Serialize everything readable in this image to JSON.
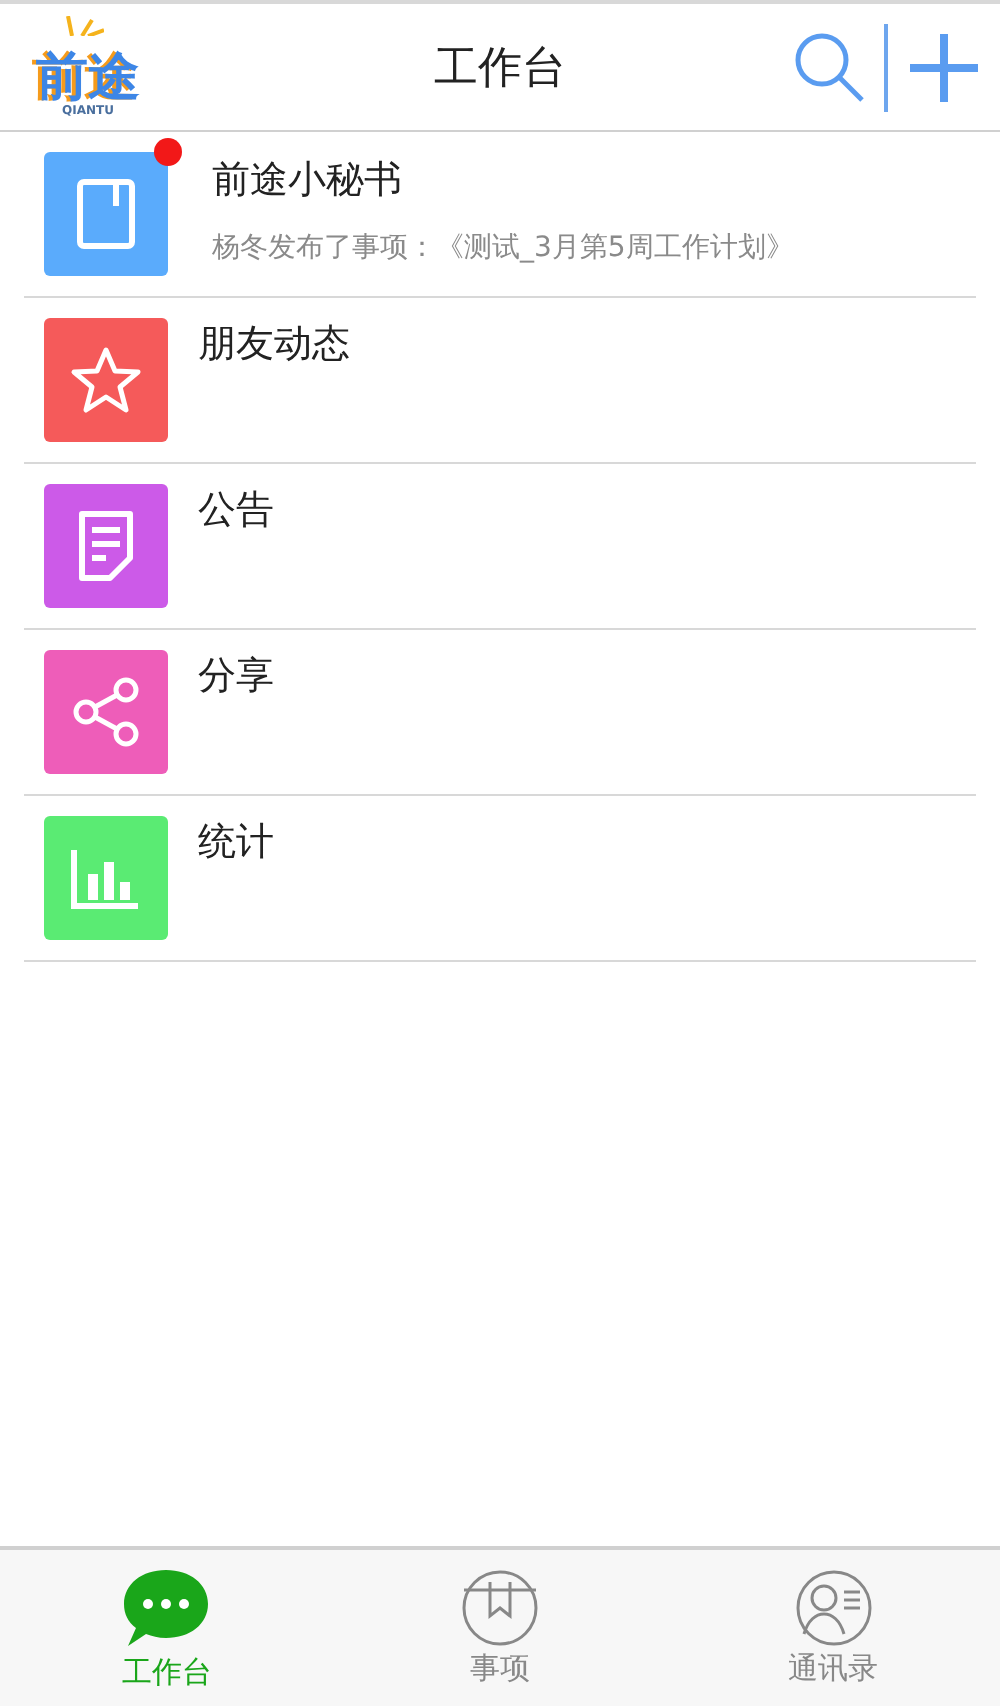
{
  "header": {
    "logo_text": "前途",
    "logo_subtext": "QIANTU",
    "title": "工作台"
  },
  "items": [
    {
      "title": "前途小秘书",
      "subtitle": "杨冬发布了事项：《测试_3月第5周工作计划》",
      "kind": "book",
      "color": "#5aabfc",
      "unread": true
    },
    {
      "title": "朋友动态",
      "kind": "star",
      "color": "#f55a5a",
      "unread": false
    },
    {
      "title": "公告",
      "kind": "note",
      "color": "#cc5ae8",
      "unread": false
    },
    {
      "title": "分享",
      "kind": "share",
      "color": "#ee5db9",
      "unread": false
    },
    {
      "title": "统计",
      "kind": "chart",
      "color": "#5aeb73",
      "unread": false
    }
  ],
  "tabs": [
    {
      "label": "工作台",
      "kind": "chat",
      "selected": true
    },
    {
      "label": "事项",
      "kind": "bookmark",
      "selected": false
    },
    {
      "label": "通讯录",
      "kind": "contact",
      "selected": false
    }
  ]
}
